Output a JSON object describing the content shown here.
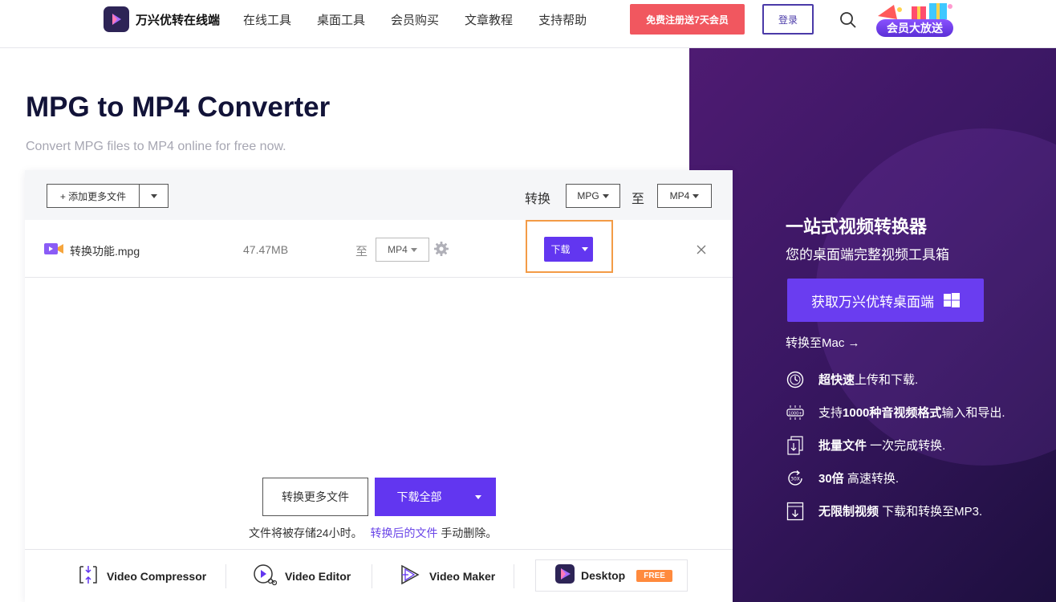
{
  "header": {
    "logo_text": "万兴优转在线端",
    "nav": [
      "在线工具",
      "桌面工具",
      "会员购买",
      "文章教程",
      "支持帮助"
    ],
    "promo_button": "免费注册送7天会员",
    "login_button": "登录",
    "vip_badge": "会员大放送"
  },
  "hero": {
    "title": "MPG to MP4 Converter",
    "subtitle": "Convert MPG files to MP4 online for free now."
  },
  "converter": {
    "add_files": "+ 添加更多文件",
    "convert_label": "转换",
    "from_format": "MPG",
    "to_label": "至",
    "to_format": "MP4",
    "file": {
      "name": "转换功能.mpg",
      "size": "47.47MB",
      "to_label": "至",
      "format": "MP4",
      "download": "下载"
    },
    "convert_more": "转换更多文件",
    "download_all": "下载全部",
    "store_note_pre": "文件将被存储24小时。",
    "store_note_link": "转换后的文件",
    "store_note_post": "手动删除。"
  },
  "tools": {
    "compressor": "Video Compressor",
    "editor": "Video Editor",
    "maker": "Video Maker",
    "desktop": "Desktop",
    "free": "FREE"
  },
  "side": {
    "title": "一站式视频转换器",
    "subtitle": "您的桌面端完整视频工具箱",
    "cta": "获取万兴优转桌面端",
    "mac_link": "转换至Mac →",
    "features": [
      {
        "icon": "speed-icon",
        "bold": "超快速",
        "text": "上传和下载."
      },
      {
        "icon": "formats-icon",
        "pre": "支持",
        "bold": "1000种音视频格式",
        "text": "输入和导出."
      },
      {
        "icon": "batch-icon",
        "bold": "批量文件",
        "text": " 一次完成转换."
      },
      {
        "icon": "fast-30x-icon",
        "bold": "30倍",
        "text": " 高速转换."
      },
      {
        "icon": "unlimited-download-icon",
        "bold": "无限制视频",
        "text": " 下载和转换至MP3."
      }
    ]
  },
  "colors": {
    "accent": "#6236f0",
    "promo": "#f1575f",
    "highlight": "#f39b46",
    "panel": "#3a1763"
  }
}
